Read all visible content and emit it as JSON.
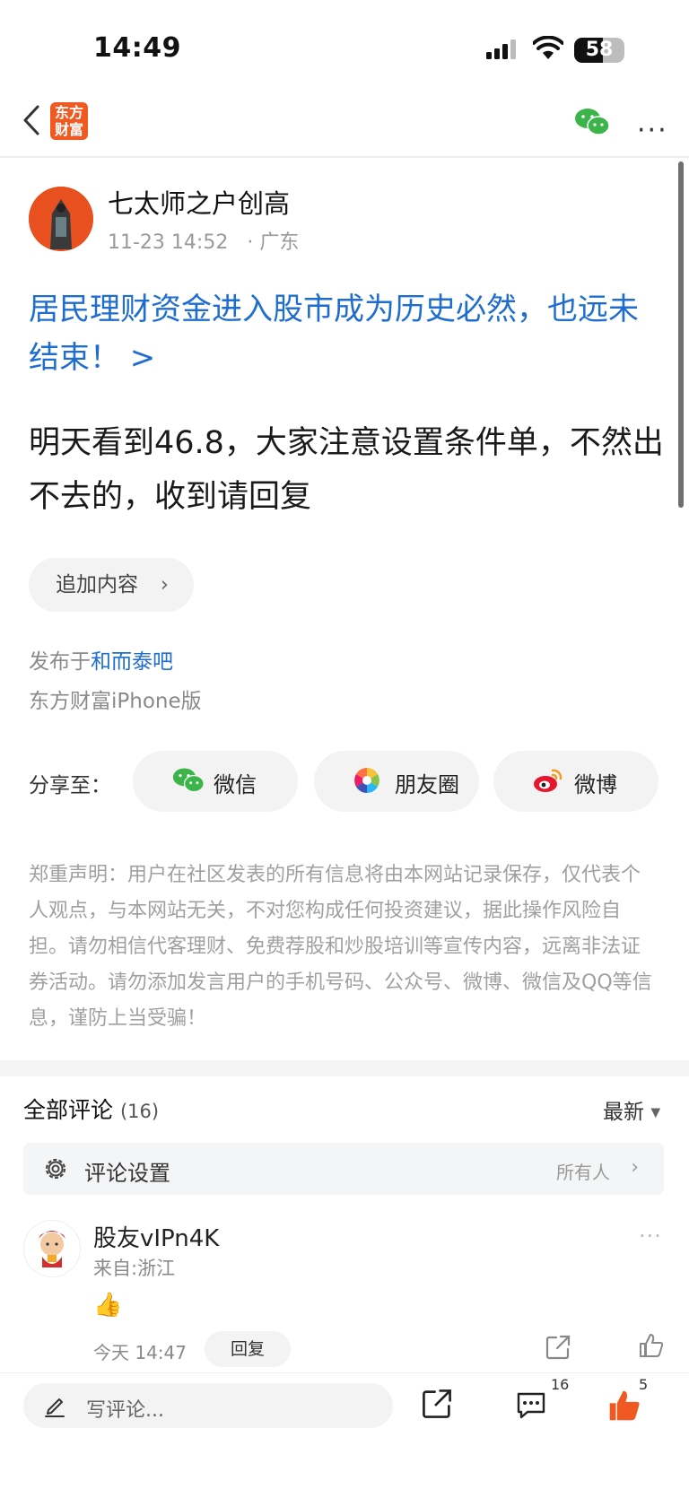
{
  "status_bar": {
    "time": "14:49",
    "battery": "58",
    "battery_level_percent": 58
  },
  "nav": {
    "logo_text": "东方财富"
  },
  "post": {
    "author": "七太师之户创高",
    "datetime": "11-23 14:52",
    "location": "· 广东",
    "topic": "居民理财资金进入股市成为历史必然，也远未结束！ >",
    "content": "明天看到46.8，大家注意设置条件单，不然出不去的，收到请回复",
    "add_content_label": "追加内容",
    "published_prefix": "发布于",
    "forum_name": "和而泰吧",
    "client": "东方财富iPhone版"
  },
  "share": {
    "label": "分享至：",
    "buttons": [
      "微信",
      "朋友圈",
      "微博"
    ]
  },
  "disclaimer": "郑重声明：用户在社区发表的所有信息将由本网站记录保存，仅代表个人观点，与本网站无关，不对您构成任何投资建议，据此操作风险自担。请勿相信代客理财、免费荐股和炒股培训等宣传内容，远离非法证券活动。请勿添加发言用户的手机号码、公众号、微博、微信及QQ等信息，谨防上当受骗！",
  "comments": {
    "title": "全部评论",
    "count": "(16)",
    "sort": "最新",
    "settings_label": "评论设置",
    "settings_value": "所有人",
    "items": [
      {
        "user": "股友vIPn4K",
        "location": "来自:浙江",
        "content": "👍",
        "time": "今天 14:47",
        "reply_label": "回复"
      }
    ]
  },
  "bottom_bar": {
    "input_placeholder": "写评论...",
    "comment_count": "16",
    "like_count": "5"
  },
  "colors": {
    "accent_blue": "#1f6ecf",
    "brand_orange": "#f05a22",
    "like_orange": "#f05a22"
  }
}
